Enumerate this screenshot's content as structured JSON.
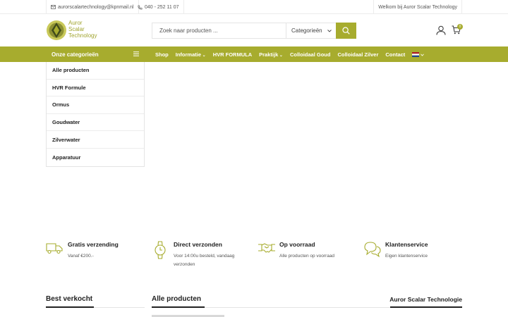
{
  "topbar": {
    "email": "aurorscalartechnology@kpnmail.nl",
    "phone": "040 - 252 11 07",
    "welcome": "Welkom bij Auror Scalar Technology"
  },
  "logo": {
    "line1": "Auror",
    "line2": "Scalar",
    "line3": "Technology"
  },
  "search": {
    "placeholder": "Zoek naar producten ...",
    "category": "Categorieën"
  },
  "cart": {
    "count": "0"
  },
  "nav": {
    "categories_label": "Onze categorieën",
    "items": [
      {
        "label": "Shop"
      },
      {
        "label": "Informatie"
      },
      {
        "label": "HVR FORMULA"
      },
      {
        "label": "Praktijk"
      },
      {
        "label": "Colloidaal Goud"
      },
      {
        "label": "Colloidaal Zilver"
      },
      {
        "label": "Contact"
      }
    ]
  },
  "categories": [
    {
      "label": "Alle producten"
    },
    {
      "label": "HVR Formule"
    },
    {
      "label": "Ormus"
    },
    {
      "label": "Goudwater"
    },
    {
      "label": "Zilverwater"
    },
    {
      "label": "Apparatuur"
    }
  ],
  "features": [
    {
      "title": "Gratis verzending",
      "text": "Vanaf €200.-",
      "icon": "truck-icon"
    },
    {
      "title": "Direct verzonden",
      "text": "Voor 14:00u besteld, vandaag verzonden",
      "icon": "watch-icon"
    },
    {
      "title": "Op voorraad",
      "text": "Alle producten op voorraad",
      "icon": "handshake-icon"
    },
    {
      "title": "Klantenservice",
      "text": "Eigen klantenservice",
      "icon": "chat-icon"
    }
  ],
  "sections": {
    "best": "Best verkocht",
    "all": "Alle producten",
    "brand": "Auror Scalar Technologie"
  },
  "colors": {
    "accent": "#a7ac2e"
  }
}
